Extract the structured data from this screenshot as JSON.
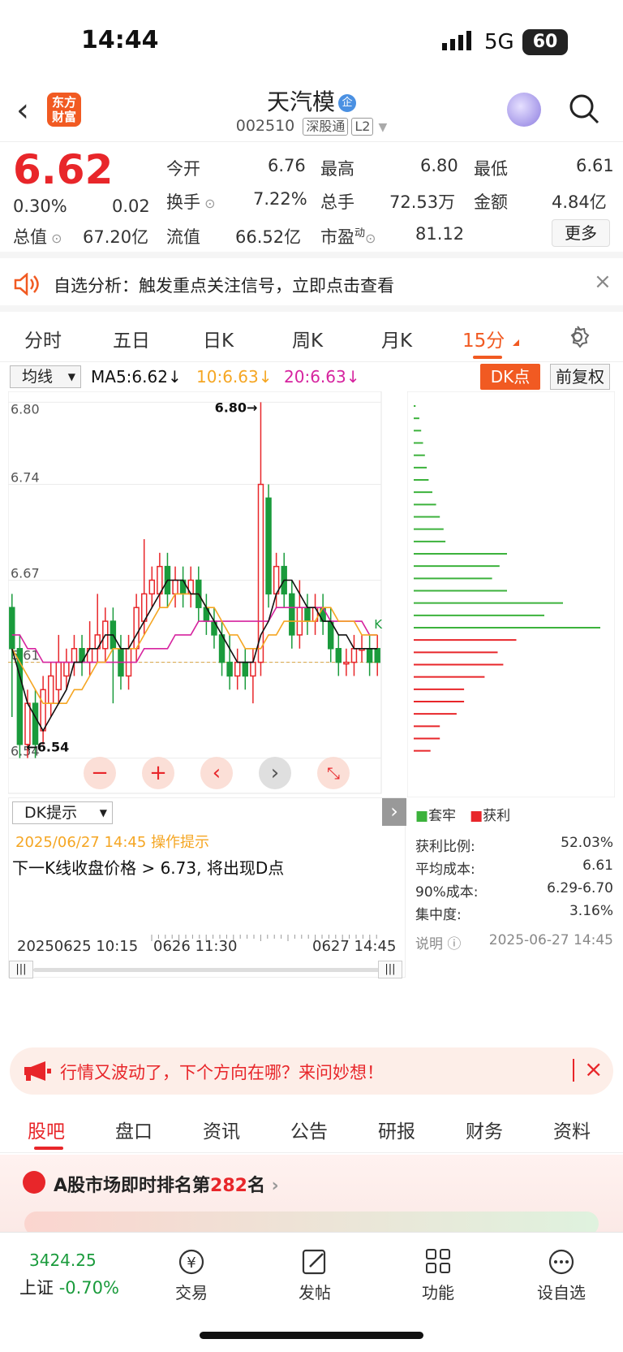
{
  "status_bar": {
    "time": "14:44",
    "network": "5G",
    "battery": "60"
  },
  "header": {
    "logo_text_1": "东方",
    "logo_text_2": "财富",
    "stock_name": "天汽模",
    "badge": "企",
    "stock_code": "002510",
    "tag1": "深股通",
    "tag2": "L2"
  },
  "quote": {
    "price": "6.62",
    "change_pct": "0.30%",
    "change_amt": "0.02",
    "open_label": "今开",
    "open": "6.76",
    "high_label": "最高",
    "high": "6.80",
    "low_label": "最低",
    "low": "6.61",
    "turnover_label": "换手",
    "turnover": "7.22%",
    "volume_label": "总手",
    "volume": "72.53万",
    "amount_label": "金额",
    "amount": "4.84亿",
    "mktcap_label": "总值",
    "mktcap": "67.20亿",
    "float_label": "流值",
    "float": "66.52亿",
    "pe_label": "市盈",
    "pe_sup": "动",
    "pe": "81.12",
    "more": "更多"
  },
  "notice": {
    "text": "自选分析：触发重点关注信号，立即点击查看"
  },
  "period_tabs": [
    "分时",
    "五日",
    "日K",
    "周K",
    "月K",
    "15分"
  ],
  "active_period": "15分",
  "ma_bar": {
    "selector": "均线",
    "ma5": "MA5:6.62",
    "ma10": "10:6.63",
    "ma20": "20:6.63",
    "dk": "DK点",
    "adjust": "前复权"
  },
  "chart_data": {
    "type": "candlestick",
    "y_ticks": [
      "6.80",
      "6.74",
      "6.67",
      "6.61",
      "6.54"
    ],
    "ylim": [
      6.535,
      6.805
    ],
    "max_label": "6.80→",
    "min_label": "←6.54",
    "k_marker": "K",
    "candles": [
      [
        6.65,
        6.62,
        6.66,
        6.57
      ],
      [
        6.62,
        6.55,
        6.63,
        6.54
      ],
      [
        6.55,
        6.58,
        6.59,
        6.54
      ],
      [
        6.58,
        6.55,
        6.59,
        6.54
      ],
      [
        6.56,
        6.59,
        6.6,
        6.55
      ],
      [
        6.58,
        6.6,
        6.61,
        6.57
      ],
      [
        6.59,
        6.61,
        6.63,
        6.58
      ],
      [
        6.6,
        6.61,
        6.62,
        6.59
      ],
      [
        6.61,
        6.62,
        6.63,
        6.6
      ],
      [
        6.62,
        6.61,
        6.63,
        6.6
      ],
      [
        6.61,
        6.62,
        6.64,
        6.6
      ],
      [
        6.62,
        6.63,
        6.66,
        6.61
      ],
      [
        6.62,
        6.64,
        6.65,
        6.61
      ],
      [
        6.64,
        6.62,
        6.65,
        6.58
      ],
      [
        6.62,
        6.6,
        6.63,
        6.59
      ],
      [
        6.6,
        6.62,
        6.63,
        6.59
      ],
      [
        6.62,
        6.65,
        6.66,
        6.61
      ],
      [
        6.64,
        6.66,
        6.7,
        6.63
      ],
      [
        6.66,
        6.67,
        6.68,
        6.65
      ],
      [
        6.66,
        6.68,
        6.69,
        6.65
      ],
      [
        6.68,
        6.66,
        6.69,
        6.65
      ],
      [
        6.66,
        6.67,
        6.68,
        6.65
      ],
      [
        6.67,
        6.66,
        6.68,
        6.65
      ],
      [
        6.66,
        6.67,
        6.68,
        6.65
      ],
      [
        6.67,
        6.65,
        6.68,
        6.64
      ],
      [
        6.65,
        6.64,
        6.66,
        6.63
      ],
      [
        6.64,
        6.63,
        6.65,
        6.62
      ],
      [
        6.63,
        6.61,
        6.64,
        6.6
      ],
      [
        6.61,
        6.6,
        6.63,
        6.59
      ],
      [
        6.6,
        6.61,
        6.62,
        6.59
      ],
      [
        6.61,
        6.6,
        6.62,
        6.59
      ],
      [
        6.6,
        6.61,
        6.62,
        6.58
      ],
      [
        6.61,
        6.74,
        6.8,
        6.6
      ],
      [
        6.73,
        6.66,
        6.74,
        6.65
      ],
      [
        6.66,
        6.68,
        6.69,
        6.65
      ],
      [
        6.68,
        6.66,
        6.69,
        6.65
      ],
      [
        6.66,
        6.63,
        6.67,
        6.62
      ],
      [
        6.63,
        6.65,
        6.67,
        6.62
      ],
      [
        6.65,
        6.64,
        6.66,
        6.63
      ],
      [
        6.64,
        6.65,
        6.66,
        6.63
      ],
      [
        6.65,
        6.64,
        6.66,
        6.63
      ],
      [
        6.64,
        6.62,
        6.65,
        6.61
      ],
      [
        6.62,
        6.61,
        6.63,
        6.6
      ],
      [
        6.61,
        6.61,
        6.62,
        6.6
      ],
      [
        6.61,
        6.62,
        6.63,
        6.6
      ],
      [
        6.62,
        6.62,
        6.63,
        6.61
      ],
      [
        6.62,
        6.61,
        6.63,
        6.6
      ],
      [
        6.61,
        6.62,
        6.63,
        6.6
      ]
    ],
    "ma5": [
      6.62,
      6.6,
      6.58,
      6.57,
      6.56,
      6.57,
      6.58,
      6.59,
      6.61,
      6.61,
      6.62,
      6.62,
      6.63,
      6.63,
      6.62,
      6.62,
      6.63,
      6.64,
      6.65,
      6.66,
      6.67,
      6.67,
      6.67,
      6.66,
      6.66,
      6.65,
      6.64,
      6.63,
      6.62,
      6.61,
      6.61,
      6.61,
      6.63,
      6.64,
      6.66,
      6.67,
      6.67,
      6.66,
      6.65,
      6.65,
      6.64,
      6.64,
      6.63,
      6.63,
      6.62,
      6.62,
      6.62,
      6.62
    ],
    "ma10": [
      6.62,
      6.61,
      6.6,
      6.59,
      6.58,
      6.58,
      6.58,
      6.58,
      6.59,
      6.59,
      6.6,
      6.61,
      6.61,
      6.62,
      6.62,
      6.62,
      6.62,
      6.63,
      6.64,
      6.65,
      6.65,
      6.66,
      6.66,
      6.66,
      6.66,
      6.65,
      6.65,
      6.64,
      6.63,
      6.63,
      6.62,
      6.62,
      6.62,
      6.63,
      6.63,
      6.64,
      6.64,
      6.64,
      6.64,
      6.64,
      6.65,
      6.65,
      6.64,
      6.64,
      6.64,
      6.63,
      6.63,
      6.63
    ],
    "ma20": [
      6.63,
      6.63,
      6.62,
      6.62,
      6.61,
      6.61,
      6.61,
      6.61,
      6.61,
      6.61,
      6.61,
      6.61,
      6.61,
      6.61,
      6.61,
      6.61,
      6.61,
      6.62,
      6.62,
      6.62,
      6.62,
      6.63,
      6.63,
      6.63,
      6.64,
      6.64,
      6.64,
      6.64,
      6.64,
      6.64,
      6.64,
      6.64,
      6.64,
      6.64,
      6.65,
      6.65,
      6.65,
      6.65,
      6.65,
      6.65,
      6.65,
      6.64,
      6.64,
      6.64,
      6.64,
      6.64,
      6.63,
      6.63
    ],
    "avg_cost": 6.61,
    "chip_volumes_top_to_bottom": [
      1,
      3,
      4,
      5,
      6,
      7,
      8,
      10,
      12,
      14,
      16,
      17,
      50,
      46,
      42,
      50,
      80,
      70,
      100,
      55,
      45,
      48,
      38,
      27,
      27,
      23,
      14,
      14,
      9
    ],
    "chip_split_index": 19
  },
  "chip_legend": {
    "trapped": "套牢",
    "profit": "获利"
  },
  "chip_info": {
    "rows": [
      {
        "label": "获利比例:",
        "value": "52.03%"
      },
      {
        "label": "平均成本:",
        "value": "6.61"
      },
      {
        "label": "90%成本:",
        "value": "6.29-6.70"
      },
      {
        "label": "集中度:",
        "value": "3.16%"
      }
    ],
    "note_label": "说明",
    "note_time": "2025-06-27 14:45"
  },
  "dk_panel": {
    "selector": "DK提示",
    "time": "2025/06/27 14:45 操作提示",
    "text": "下一K线收盘价格 > 6.73, 将出现D点"
  },
  "time_axis": {
    "left": "20250625 10:15",
    "mid": "0626 11:30",
    "right": "0627 14:45"
  },
  "promo": {
    "text": "行情又波动了，下个方向在哪？来问妙想！"
  },
  "bottom_tabs": [
    "股吧",
    "盘口",
    "资讯",
    "公告",
    "研报",
    "财务",
    "资料"
  ],
  "rank": {
    "prefix": "A股市场即时排名第",
    "num": "282",
    "suffix": "名"
  },
  "bottom_nav": {
    "index_value": "3424.25",
    "index_name": "上证",
    "index_change": "-0.70%",
    "trade": "交易",
    "post": "发帖",
    "function": "功能",
    "watch": "设自选"
  }
}
